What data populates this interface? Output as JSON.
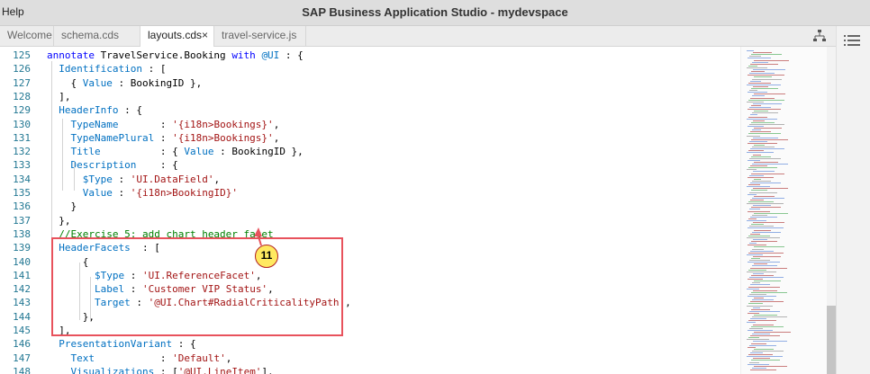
{
  "window": {
    "menu_help": "Help",
    "title": "SAP Business Application Studio - mydevspace"
  },
  "tabs": [
    {
      "label": "Welcome"
    },
    {
      "label": "schema.cds"
    },
    {
      "label": "layouts.cds",
      "close": "×"
    },
    {
      "label": "travel-service.js"
    }
  ],
  "toolbar": {
    "icons": [
      "split-editor-icon",
      "list-icon"
    ]
  },
  "callout": {
    "label": "11"
  },
  "editor": {
    "lines": [
      {
        "n": "125",
        "parts": [
          [
            "kw",
            "annotate"
          ],
          [
            "",
            " TravelService.Booking "
          ],
          [
            "kw",
            "with"
          ],
          [
            "",
            " "
          ],
          [
            "att",
            "@UI"
          ],
          [
            "",
            " : {"
          ]
        ]
      },
      {
        "n": "126",
        "parts": [
          [
            "",
            "  "
          ],
          [
            "att",
            "Identification"
          ],
          [
            "",
            " : ["
          ]
        ]
      },
      {
        "n": "127",
        "parts": [
          [
            "",
            "    { "
          ],
          [
            "att",
            "Value"
          ],
          [
            "",
            " : BookingID },"
          ]
        ]
      },
      {
        "n": "128",
        "parts": [
          [
            "",
            "  ],"
          ]
        ]
      },
      {
        "n": "129",
        "parts": [
          [
            "",
            "  "
          ],
          [
            "att",
            "HeaderInfo"
          ],
          [
            "",
            " : {"
          ]
        ]
      },
      {
        "n": "130",
        "parts": [
          [
            "",
            "    "
          ],
          [
            "att",
            "TypeName"
          ],
          [
            "",
            "       : "
          ],
          [
            "str",
            "'{i18n>Bookings}'"
          ],
          [
            "",
            ","
          ]
        ]
      },
      {
        "n": "131",
        "parts": [
          [
            "",
            "    "
          ],
          [
            "att",
            "TypeNamePlural"
          ],
          [
            "",
            " : "
          ],
          [
            "str",
            "'{i18n>Bookings}'"
          ],
          [
            "",
            ","
          ]
        ]
      },
      {
        "n": "132",
        "parts": [
          [
            "",
            "    "
          ],
          [
            "att",
            "Title"
          ],
          [
            "",
            "          : { "
          ],
          [
            "att",
            "Value"
          ],
          [
            "",
            " : BookingID },"
          ]
        ]
      },
      {
        "n": "133",
        "parts": [
          [
            "",
            "    "
          ],
          [
            "att",
            "Description"
          ],
          [
            "",
            "    : {"
          ]
        ]
      },
      {
        "n": "134",
        "parts": [
          [
            "",
            "      "
          ],
          [
            "att",
            "$Type"
          ],
          [
            "",
            " : "
          ],
          [
            "str",
            "'UI.DataField'"
          ],
          [
            "",
            ","
          ]
        ]
      },
      {
        "n": "135",
        "parts": [
          [
            "",
            "      "
          ],
          [
            "att",
            "Value"
          ],
          [
            "",
            " : "
          ],
          [
            "str",
            "'{i18n>BookingID}'"
          ]
        ]
      },
      {
        "n": "136",
        "parts": [
          [
            "",
            "    }"
          ]
        ]
      },
      {
        "n": "137",
        "parts": [
          [
            "",
            "  },"
          ]
        ]
      },
      {
        "n": "138",
        "parts": [
          [
            "",
            "  "
          ],
          [
            "cm",
            "//Exercise 5: add chart header facet"
          ]
        ]
      },
      {
        "n": "139",
        "parts": [
          [
            "",
            "  "
          ],
          [
            "att",
            "HeaderFacets"
          ],
          [
            "",
            "  : ["
          ]
        ]
      },
      {
        "n": "140",
        "parts": [
          [
            "",
            "      {"
          ]
        ]
      },
      {
        "n": "141",
        "parts": [
          [
            "",
            "        "
          ],
          [
            "att",
            "$Type"
          ],
          [
            "",
            " : "
          ],
          [
            "str",
            "'UI.ReferenceFacet'"
          ],
          [
            "",
            ","
          ]
        ]
      },
      {
        "n": "142",
        "parts": [
          [
            "",
            "        "
          ],
          [
            "att",
            "Label"
          ],
          [
            "",
            " : "
          ],
          [
            "str",
            "'Customer VIP Status'"
          ],
          [
            "",
            ","
          ]
        ]
      },
      {
        "n": "143",
        "parts": [
          [
            "",
            "        "
          ],
          [
            "att",
            "Target"
          ],
          [
            "",
            " : "
          ],
          [
            "str",
            "'@UI.Chart#RadialCriticalityPath'"
          ],
          [
            "",
            ","
          ]
        ]
      },
      {
        "n": "144",
        "parts": [
          [
            "",
            "      },"
          ]
        ]
      },
      {
        "n": "145",
        "parts": [
          [
            "",
            "  ],"
          ]
        ]
      },
      {
        "n": "146",
        "parts": [
          [
            "",
            "  "
          ],
          [
            "att",
            "PresentationVariant"
          ],
          [
            "",
            " : {"
          ]
        ]
      },
      {
        "n": "147",
        "parts": [
          [
            "",
            "    "
          ],
          [
            "att",
            "Text"
          ],
          [
            "",
            "           : "
          ],
          [
            "str",
            "'Default'"
          ],
          [
            "",
            ","
          ]
        ]
      },
      {
        "n": "148",
        "parts": [
          [
            "",
            "    "
          ],
          [
            "att",
            "Visualizations"
          ],
          [
            "",
            " : ["
          ],
          [
            "str",
            "'@UI.LineItem'"
          ],
          [
            "",
            "],"
          ]
        ]
      }
    ]
  },
  "colors": {
    "keyword": "#0000ff",
    "string": "#a31515",
    "comment": "#008000",
    "property": "#0070c1",
    "highlight_border": "#e8525c",
    "callout_fill": "#ffe960"
  }
}
